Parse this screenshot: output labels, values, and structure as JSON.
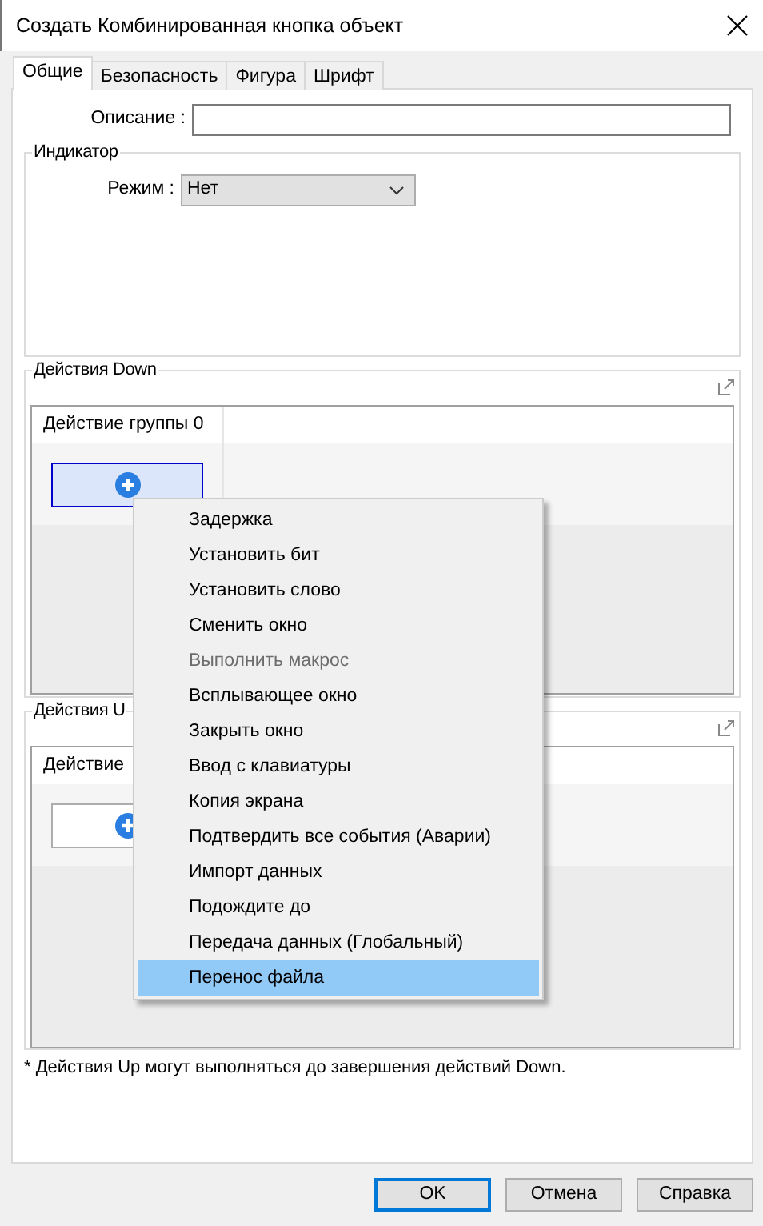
{
  "window": {
    "title": "Создать Комбинированная кнопка объект"
  },
  "tabs": [
    {
      "label": "Общие",
      "selected": true
    },
    {
      "label": "Безопасность",
      "selected": false
    },
    {
      "label": "Фигура",
      "selected": false
    },
    {
      "label": "Шрифт",
      "selected": false
    }
  ],
  "description_field": {
    "label": "Описание :"
  },
  "indicator": {
    "title": "Индикатор",
    "mode_label": "Режим :",
    "mode_value": "Нет"
  },
  "action_groups": [
    {
      "title": "Действия Down",
      "group_tab": "Действие группы 0",
      "add_focused": true
    },
    {
      "title": "Действия U",
      "group_tab": "Действие",
      "add_focused": false
    }
  ],
  "note": "* Действия Up могут выполняться до завершения действий Down.",
  "context_menu": [
    {
      "label": "Задержка",
      "disabled": false,
      "selected": false
    },
    {
      "label": "Установить бит",
      "disabled": false,
      "selected": false
    },
    {
      "label": "Установить слово",
      "disabled": false,
      "selected": false
    },
    {
      "label": "Сменить окно",
      "disabled": false,
      "selected": false
    },
    {
      "label": "Выполнить макрос",
      "disabled": true,
      "selected": false
    },
    {
      "label": "Всплывающее окно",
      "disabled": false,
      "selected": false
    },
    {
      "label": "Закрыть окно",
      "disabled": false,
      "selected": false
    },
    {
      "label": "Ввод с клавиатуры",
      "disabled": false,
      "selected": false
    },
    {
      "label": "Копия экрана",
      "disabled": false,
      "selected": false
    },
    {
      "label": "Подтвердить все события  (Аварии)",
      "disabled": false,
      "selected": false
    },
    {
      "label": "Импорт данных",
      "disabled": false,
      "selected": false
    },
    {
      "label": "Подождите до",
      "disabled": false,
      "selected": false
    },
    {
      "label": "Передача данных (Глобальный)",
      "disabled": false,
      "selected": false
    },
    {
      "label": "Перенос файла",
      "disabled": false,
      "selected": true
    }
  ],
  "buttons": [
    {
      "label": "OK",
      "default": true
    },
    {
      "label": "Отмена",
      "default": false
    },
    {
      "label": "Справка",
      "default": false
    }
  ]
}
